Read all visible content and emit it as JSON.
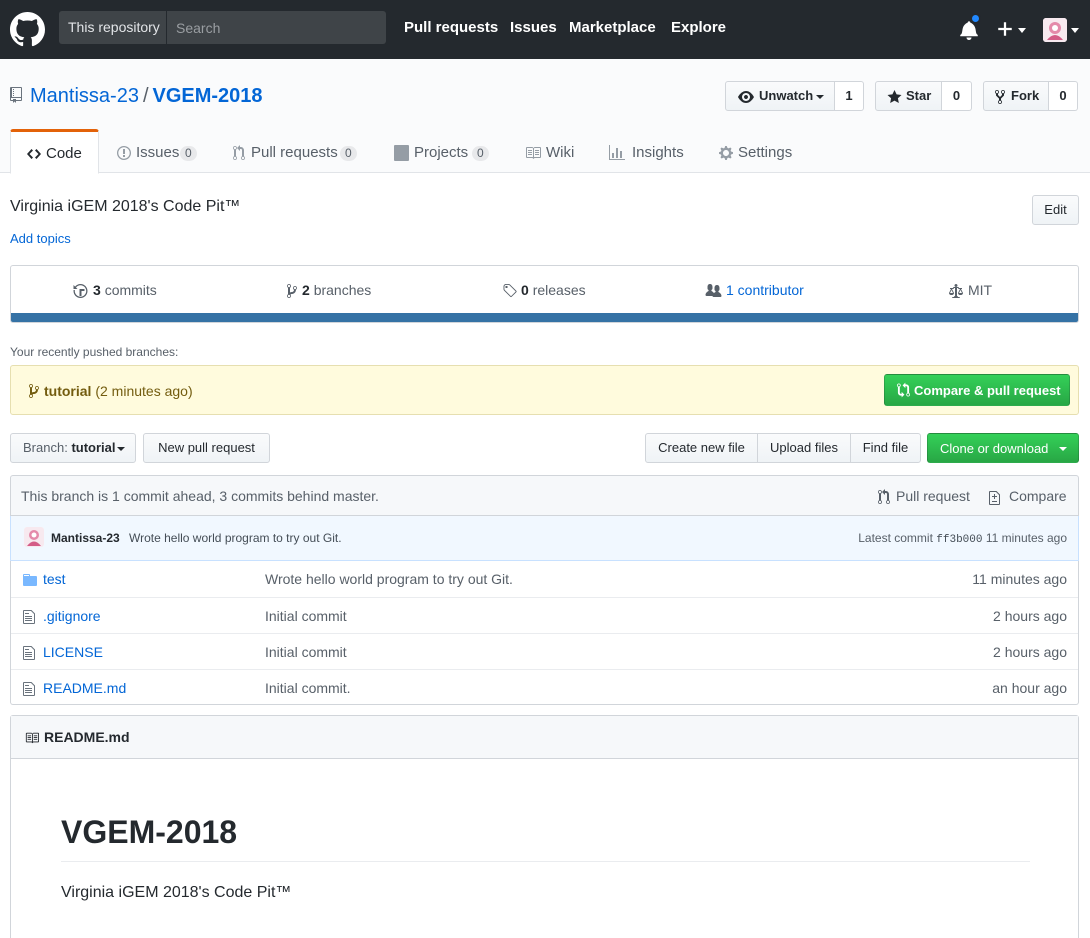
{
  "header": {
    "search_scope": "This repository",
    "search_placeholder": "Search",
    "nav": [
      "Pull requests",
      "Issues",
      "Marketplace",
      "Explore"
    ]
  },
  "repo": {
    "owner": "Mantissa-23",
    "separator": "/",
    "name": "VGEM-2018",
    "actions": {
      "watch_label": "Unwatch",
      "watch_count": "1",
      "star_label": "Star",
      "star_count": "0",
      "fork_label": "Fork",
      "fork_count": "0"
    }
  },
  "tabs": [
    {
      "label": "Code",
      "counter": null,
      "icon": "code-icon",
      "selected": true
    },
    {
      "label": "Issues",
      "counter": "0",
      "icon": "issue-icon"
    },
    {
      "label": "Pull requests",
      "counter": "0",
      "icon": "pull-request-icon"
    },
    {
      "label": "Projects",
      "counter": "0",
      "icon": "project-icon"
    },
    {
      "label": "Wiki",
      "counter": null,
      "icon": "book-icon"
    },
    {
      "label": "Insights",
      "counter": null,
      "icon": "graph-icon"
    },
    {
      "label": "Settings",
      "counter": null,
      "icon": "gear-icon"
    }
  ],
  "description": "Virginia iGEM 2018's Code Pit™",
  "add_topics": "Add topics",
  "edit_label": "Edit",
  "summary": {
    "commits_num": "3",
    "commits_label": "commits",
    "branches_num": "2",
    "branches_label": "branches",
    "releases_num": "0",
    "releases_label": "releases",
    "contributors_label": "1 contributor",
    "license": "MIT",
    "language_color": "#3572A5"
  },
  "recent": {
    "label": "Your recently pushed branches:",
    "branch": "tutorial",
    "time": "(2 minutes ago)",
    "compare_label": "Compare & pull request"
  },
  "file_nav": {
    "branch_prefix": "Branch:",
    "branch": "tutorial",
    "new_pr": "New pull request",
    "create_file": "Create new file",
    "upload_files": "Upload files",
    "find_file": "Find file",
    "clone": "Clone or download"
  },
  "branch_info": {
    "text": "This branch is 1 commit ahead, 3 commits behind master.",
    "pull_request": "Pull request",
    "compare": "Compare"
  },
  "commit": {
    "author": "Mantissa-23",
    "message": "Wrote hello world program to try out Git.",
    "latest_label": "Latest commit",
    "sha": "ff3b000",
    "age": "11 minutes ago"
  },
  "files": [
    {
      "name": "test",
      "type": "dir",
      "message": "Wrote hello world program to try out Git.",
      "age": "11 minutes ago"
    },
    {
      "name": ".gitignore",
      "type": "file",
      "message": "Initial commit",
      "age": "2 hours ago"
    },
    {
      "name": "LICENSE",
      "type": "file",
      "message": "Initial commit",
      "age": "2 hours ago"
    },
    {
      "name": "README.md",
      "type": "file",
      "message": "Initial commit.",
      "age": "an hour ago"
    }
  ],
  "readme": {
    "filename": "README.md",
    "heading": "VGEM-2018",
    "body": "Virginia iGEM 2018's Code Pit™"
  }
}
